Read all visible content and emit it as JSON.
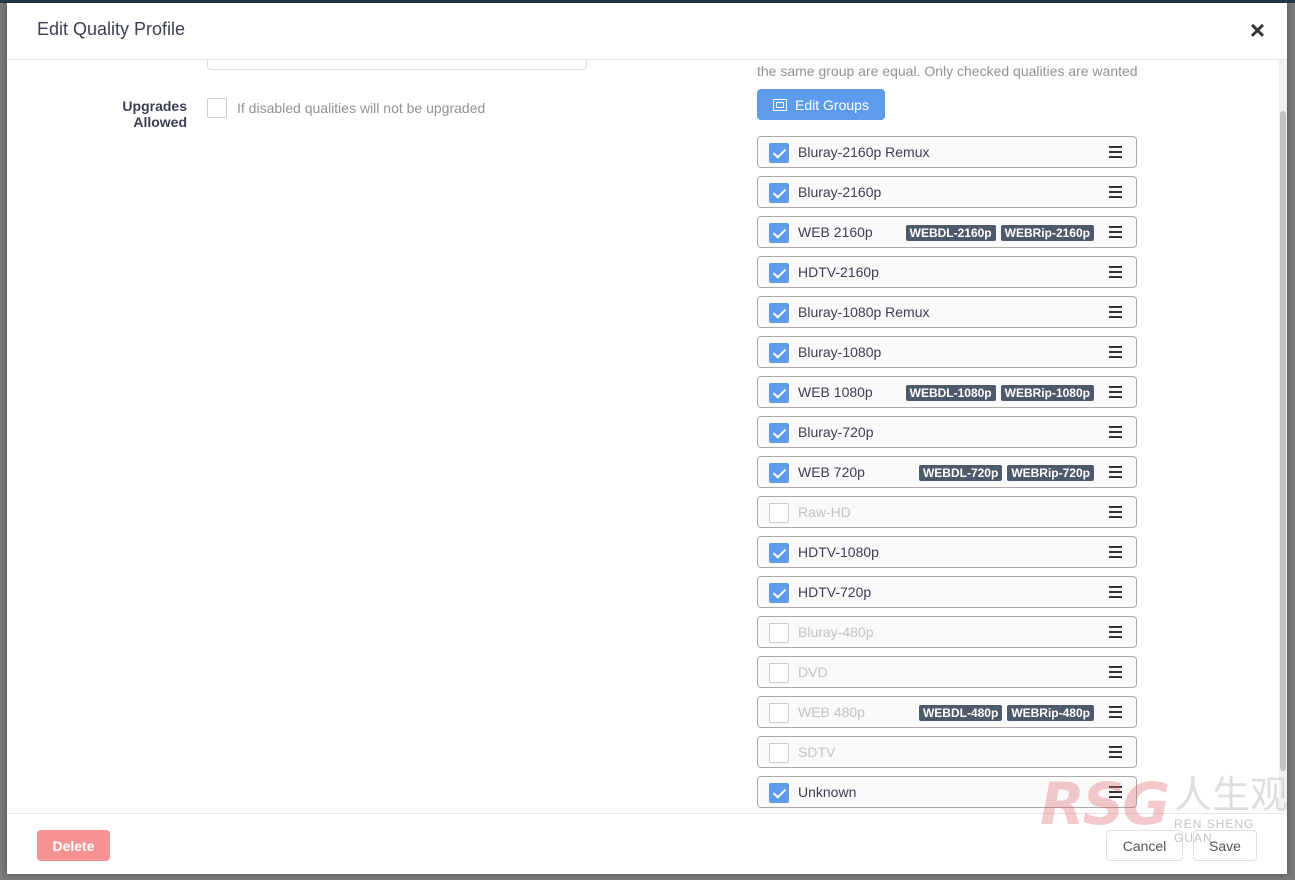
{
  "modal": {
    "title": "Edit Quality Profile",
    "close_label": "×"
  },
  "form": {
    "upgrades_label": "Upgrades Allowed",
    "upgrades_checked": false,
    "upgrades_help": "If disabled qualities will not be upgraded"
  },
  "qualities": {
    "description": "the same group are equal. Only checked qualities are wanted",
    "edit_groups_label": "Edit Groups",
    "items": [
      {
        "name": "Bluray-2160p Remux",
        "checked": true,
        "tags": []
      },
      {
        "name": "Bluray-2160p",
        "checked": true,
        "tags": []
      },
      {
        "name": "WEB 2160p",
        "checked": true,
        "tags": [
          "WEBDL-2160p",
          "WEBRip-2160p"
        ]
      },
      {
        "name": "HDTV-2160p",
        "checked": true,
        "tags": []
      },
      {
        "name": "Bluray-1080p Remux",
        "checked": true,
        "tags": []
      },
      {
        "name": "Bluray-1080p",
        "checked": true,
        "tags": []
      },
      {
        "name": "WEB 1080p",
        "checked": true,
        "tags": [
          "WEBDL-1080p",
          "WEBRip-1080p"
        ]
      },
      {
        "name": "Bluray-720p",
        "checked": true,
        "tags": []
      },
      {
        "name": "WEB 720p",
        "checked": true,
        "tags": [
          "WEBDL-720p",
          "WEBRip-720p"
        ]
      },
      {
        "name": "Raw-HD",
        "checked": false,
        "tags": []
      },
      {
        "name": "HDTV-1080p",
        "checked": true,
        "tags": []
      },
      {
        "name": "HDTV-720p",
        "checked": true,
        "tags": []
      },
      {
        "name": "Bluray-480p",
        "checked": false,
        "tags": []
      },
      {
        "name": "DVD",
        "checked": false,
        "tags": []
      },
      {
        "name": "WEB 480p",
        "checked": false,
        "tags": [
          "WEBDL-480p",
          "WEBRip-480p"
        ]
      },
      {
        "name": "SDTV",
        "checked": false,
        "tags": []
      },
      {
        "name": "Unknown",
        "checked": true,
        "tags": []
      }
    ]
  },
  "footer": {
    "delete_label": "Delete",
    "cancel_label": "Cancel",
    "save_label": "Save"
  },
  "watermark": {
    "logo": "RSG",
    "chinese": "人生观",
    "subtitle": "REN SHENG GUAN"
  },
  "colors": {
    "accent": "#5d9cec",
    "danger": "#f59392",
    "tag": "#4d5a6c"
  }
}
